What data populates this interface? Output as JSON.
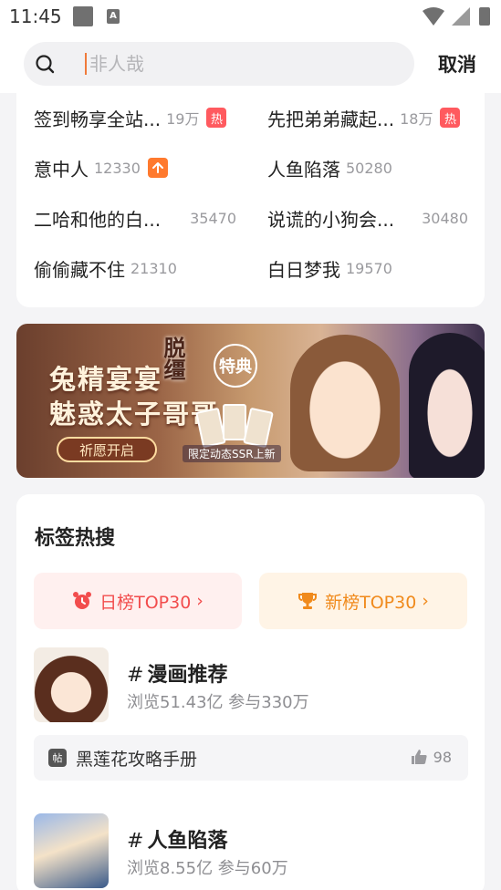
{
  "status": {
    "time": "11:45"
  },
  "search": {
    "placeholder": "非人哉",
    "cancel": "取消"
  },
  "ranking": {
    "items": [
      {
        "title": "签到畅享全站...",
        "count": "19万",
        "badge": "热",
        "badge_type": "hot"
      },
      {
        "title": "先把弟弟藏起...",
        "count": "18万",
        "badge": "热",
        "badge_type": "hot"
      },
      {
        "title": "意中人",
        "count": "12330",
        "badge": "↑",
        "badge_type": "up"
      },
      {
        "title": "人鱼陷落",
        "count": "50280"
      },
      {
        "title": "二哈和他的白...",
        "count": "35470"
      },
      {
        "title": "说谎的小狗会...",
        "count": "30480"
      },
      {
        "title": "偷偷藏不住",
        "count": "21310"
      },
      {
        "title": "白日梦我",
        "count": "19570"
      }
    ]
  },
  "banner": {
    "line1": "兔精宴宴",
    "line2": "魅惑太子哥哥",
    "stamp": "脱缰",
    "special": "特典",
    "wish_button": "祈愿开启",
    "ssr_label": "限定动态SSR上新"
  },
  "tags_section": {
    "title": "标签热搜",
    "daily_label": "日榜TOP30",
    "new_label": "新榜TOP30",
    "colors": {
      "daily": "#f24d4d",
      "new": "#f08a1c"
    },
    "topics": [
      {
        "hash": "#",
        "name": "漫画推荐",
        "meta": "浏览51.43亿 参与330万"
      },
      {
        "hash": "#",
        "name": "人鱼陷落",
        "meta": "浏览8.55亿 参与60万"
      }
    ],
    "post": {
      "tag": "帖",
      "title": "黑莲花攻略手册",
      "likes": "98"
    }
  }
}
